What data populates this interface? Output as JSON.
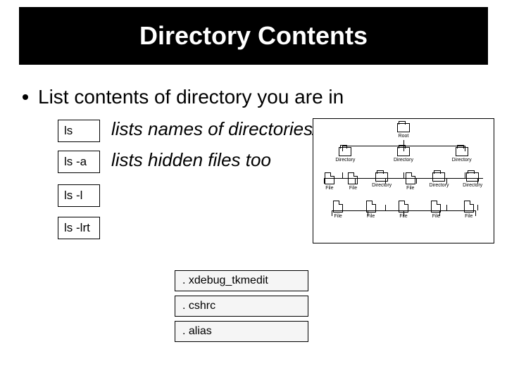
{
  "title": "Directory Contents",
  "bullet": "List contents of directory you are in",
  "commands": {
    "c1": {
      "cmd": "ls",
      "desc": "lists names of directories/files"
    },
    "c2": {
      "cmd": "ls  -a",
      "desc": "lists hidden files too"
    },
    "c3": {
      "cmd": "ls  -l"
    },
    "c4": {
      "cmd": "ls  -lrt"
    }
  },
  "hidden_files": {
    "f1": ". xdebug_tkmedit",
    "f2": ". cshrc",
    "f3": ". alias"
  },
  "tree": {
    "root": "Root",
    "level1": [
      "Directory",
      "Directory",
      "Directory"
    ],
    "level2": [
      "File",
      "File",
      "Directory",
      "File",
      "Directory",
      "Directory"
    ],
    "level3": [
      "File",
      "File",
      "File",
      "File",
      "File"
    ]
  }
}
